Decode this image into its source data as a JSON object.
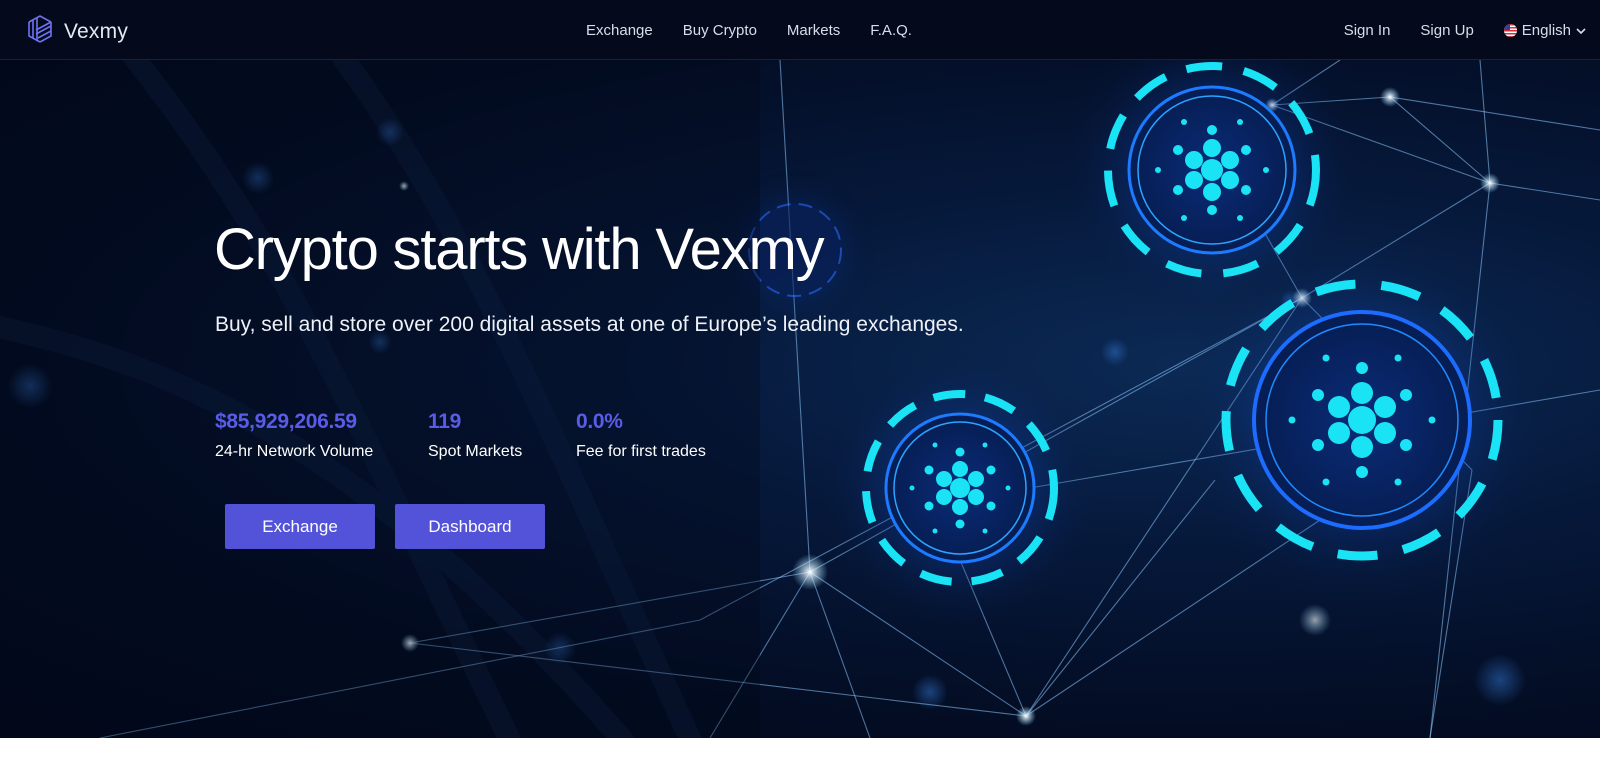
{
  "brand": {
    "name": "Vexmy",
    "icon": "vexmy-logo-icon"
  },
  "nav": {
    "links": [
      {
        "label": "Exchange"
      },
      {
        "label": "Buy Crypto"
      },
      {
        "label": "Markets"
      },
      {
        "label": "F.A.Q."
      }
    ],
    "sign_in": "Sign In",
    "sign_up": "Sign Up",
    "language": "English",
    "language_icon": "us-flag-icon"
  },
  "hero": {
    "title": "Crypto starts with Vexmy",
    "subtitle": "Buy, sell and store over 200 digital assets at one of Europe’s leading exchanges.",
    "stats": [
      {
        "value": "$85,929,206.59",
        "label": "24-hr Network Volume"
      },
      {
        "value": "119",
        "label": "Spot Markets"
      },
      {
        "value": "0.0%",
        "label": "Fee for first trades"
      }
    ],
    "buttons": {
      "exchange": "Exchange",
      "dashboard": "Dashboard"
    }
  },
  "colors": {
    "accent": "#5253d9",
    "stat_value": "#5a5ce8",
    "nav_background": "#040a1c",
    "glow": "#19e3f5"
  }
}
